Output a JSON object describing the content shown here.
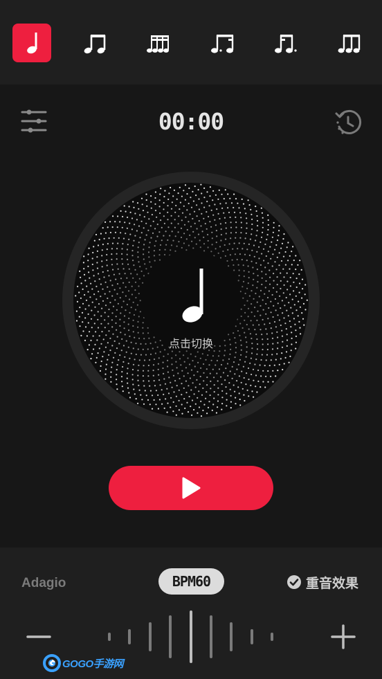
{
  "note_tabs": [
    {
      "name": "quarter",
      "icon": "quarter-note-icon",
      "active": true
    },
    {
      "name": "eighths",
      "icon": "eighth-notes-icon",
      "active": false
    },
    {
      "name": "sixteenths",
      "icon": "sixteenth-notes-icon",
      "active": false
    },
    {
      "name": "dotted-eighth-sixteenth",
      "icon": "dotted-rhythm-icon",
      "active": false
    },
    {
      "name": "sixteenth-dotted-eighth",
      "icon": "reverse-dotted-rhythm-icon",
      "active": false
    },
    {
      "name": "triplets",
      "icon": "triplet-notes-icon",
      "active": false
    }
  ],
  "timer": "00:00",
  "disc": {
    "hint": "点击切换",
    "icon": "quarter-note-icon"
  },
  "controls": {
    "play_icon": "play-icon",
    "settings_icon": "sliders-icon",
    "history_icon": "history-icon"
  },
  "bottom": {
    "tempo_name": "Adagio",
    "bpm_label": "BPM",
    "bpm_value": "60",
    "accent_label": "重音效果",
    "accent_checked": true,
    "minus_icon": "minus-icon",
    "plus_icon": "plus-icon"
  },
  "watermark": {
    "text": "GOGO手游网"
  },
  "colors": {
    "accent": "#ee1f3f",
    "background": "#171717",
    "panel": "#1f1f1f"
  }
}
